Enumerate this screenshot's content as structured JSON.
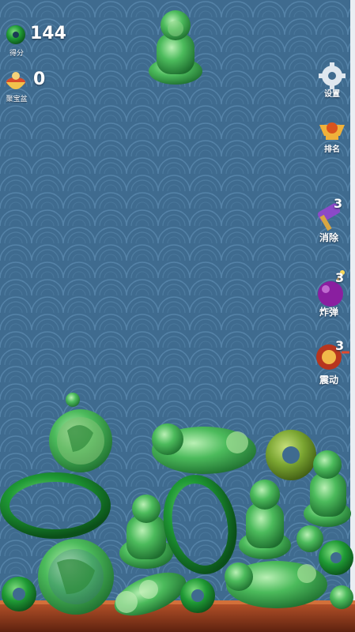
{
  "hud": {
    "score_value": "144",
    "score_label": "得分",
    "treasure_value": "0",
    "treasure_label": "聚宝盆"
  },
  "side": {
    "settings_label": "设置",
    "rank_label": "排名",
    "remove_label": "消除",
    "remove_count": "3",
    "bomb_label": "炸弹",
    "bomb_count": "3",
    "shake_label": "震动",
    "shake_count": "3"
  },
  "colors": {
    "background": "#3f6b8f",
    "jade": "#2e9e4a",
    "jade_light": "#7fd08a",
    "wood": "#8a3a1e"
  }
}
